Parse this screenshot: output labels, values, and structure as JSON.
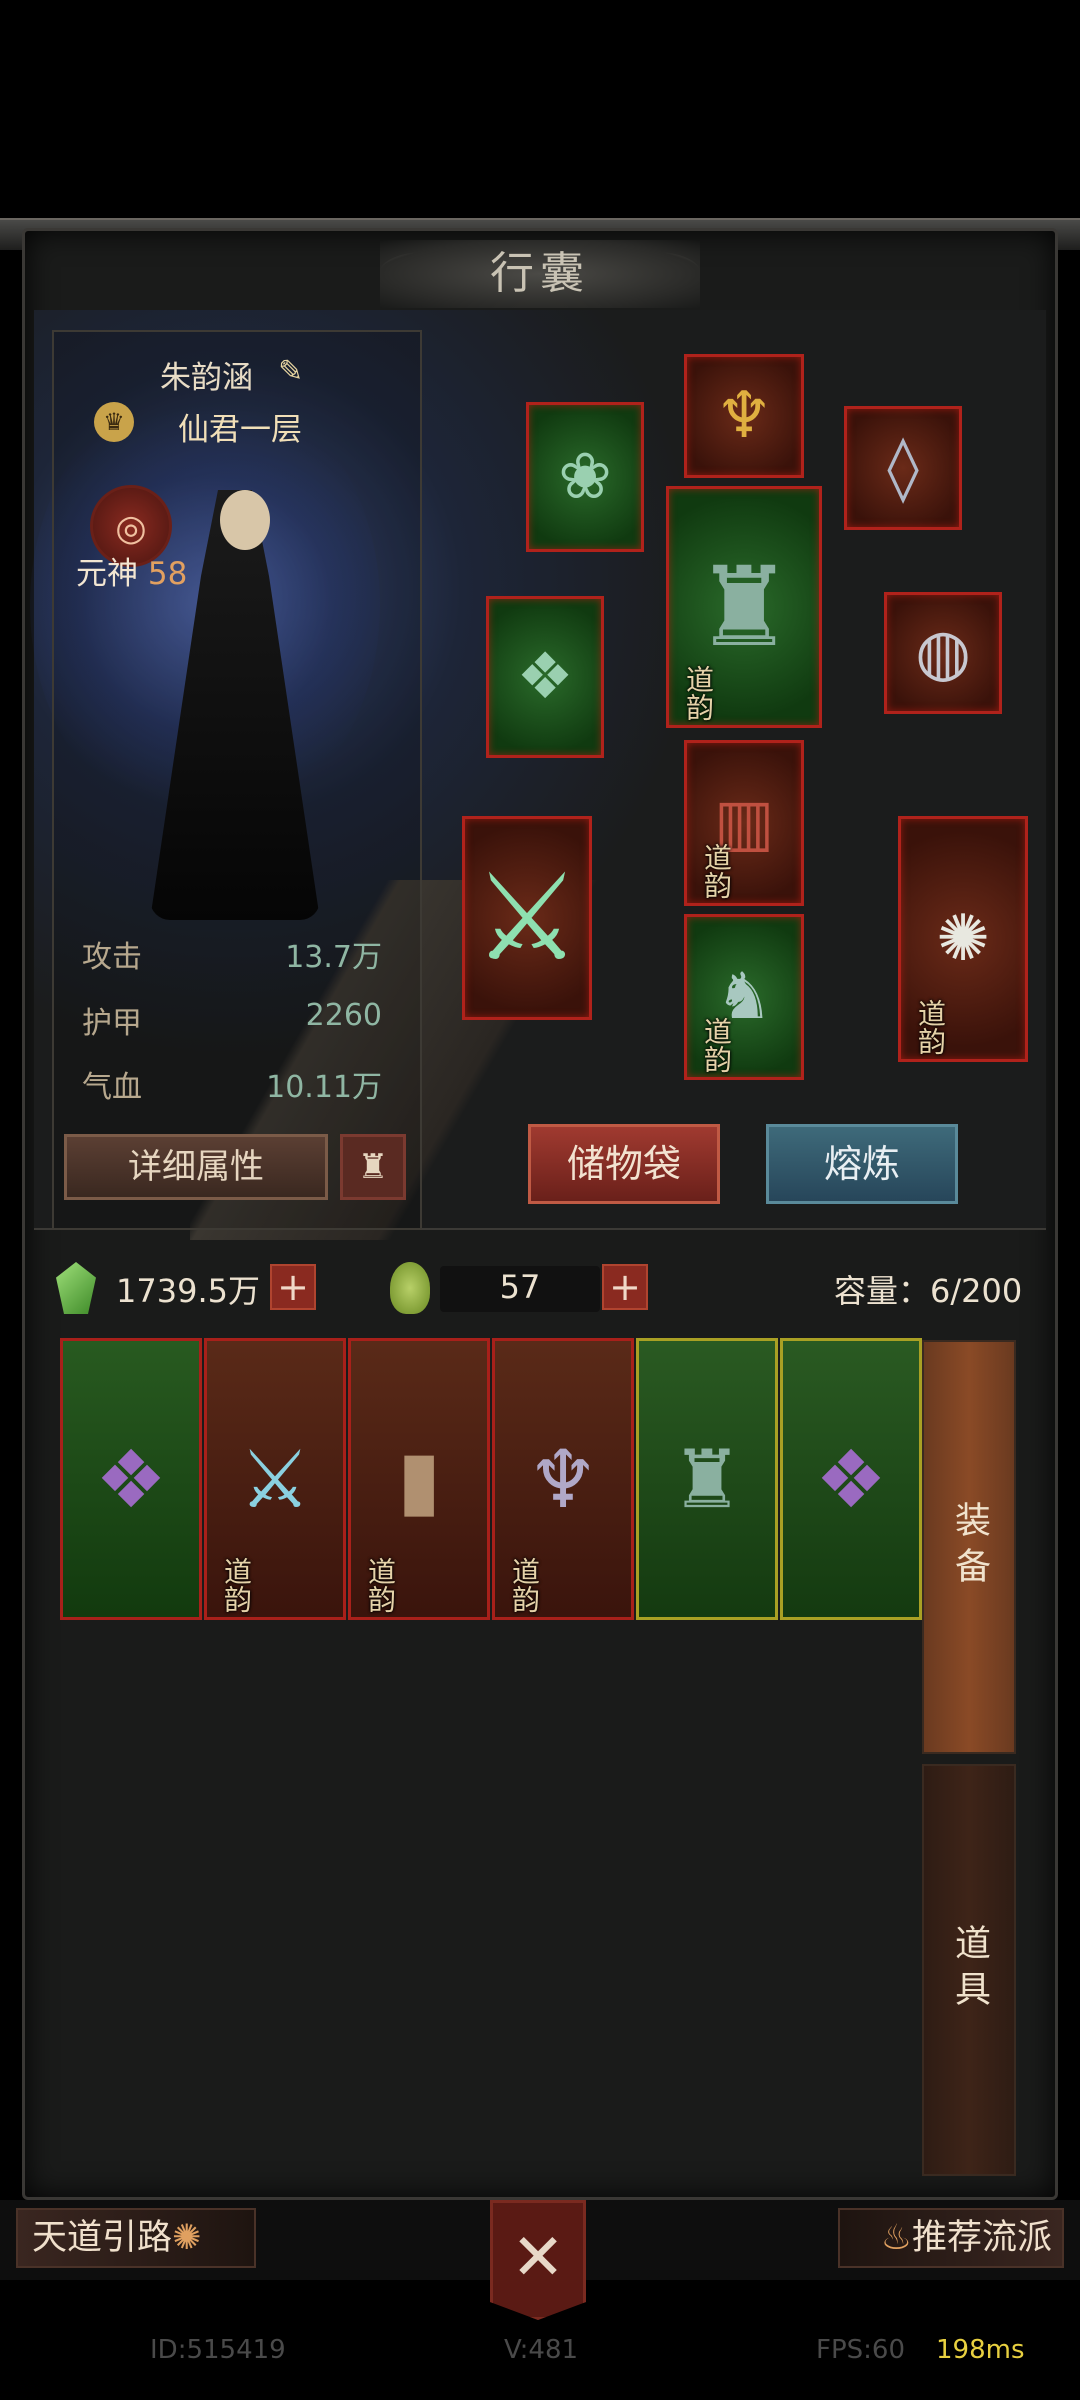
{
  "header": {
    "title": "行囊"
  },
  "character": {
    "name": "朱韵涵",
    "rank": "仙君一层",
    "soul_label": "元神",
    "soul_level": "58",
    "stats": [
      {
        "label": "攻击",
        "value": "13.7万"
      },
      {
        "label": "护甲",
        "value": "2260"
      },
      {
        "label": "气血",
        "value": "10.11万"
      }
    ]
  },
  "equipment_tag": "道韵",
  "buttons": {
    "detail": "详细属性",
    "storage_bag": "储物袋",
    "smelt": "熔炼"
  },
  "currency": {
    "spirit_stone": "1739.5万",
    "jade": "57",
    "capacity_label": "容量：",
    "capacity_value": "6/200"
  },
  "inventory": [
    {
      "name": "bracer",
      "tag": ""
    },
    {
      "name": "sword",
      "tag": "道韵"
    },
    {
      "name": "scroll",
      "tag": "道韵"
    },
    {
      "name": "hairpin",
      "tag": "道韵"
    },
    {
      "name": "robe",
      "tag": ""
    },
    {
      "name": "bracer",
      "tag": ""
    }
  ],
  "tabs": {
    "equip": "装备",
    "items": "道具"
  },
  "nav": {
    "left": "天道引路",
    "right": "推荐流派"
  },
  "footer": {
    "id": "ID:515419",
    "version": "V:481",
    "fps": "FPS:60",
    "latency": "198ms"
  },
  "colors": {
    "slot_border": "#b0221b",
    "accent_gold": "#e8d040",
    "smelt_button": "#3e6a7a"
  }
}
